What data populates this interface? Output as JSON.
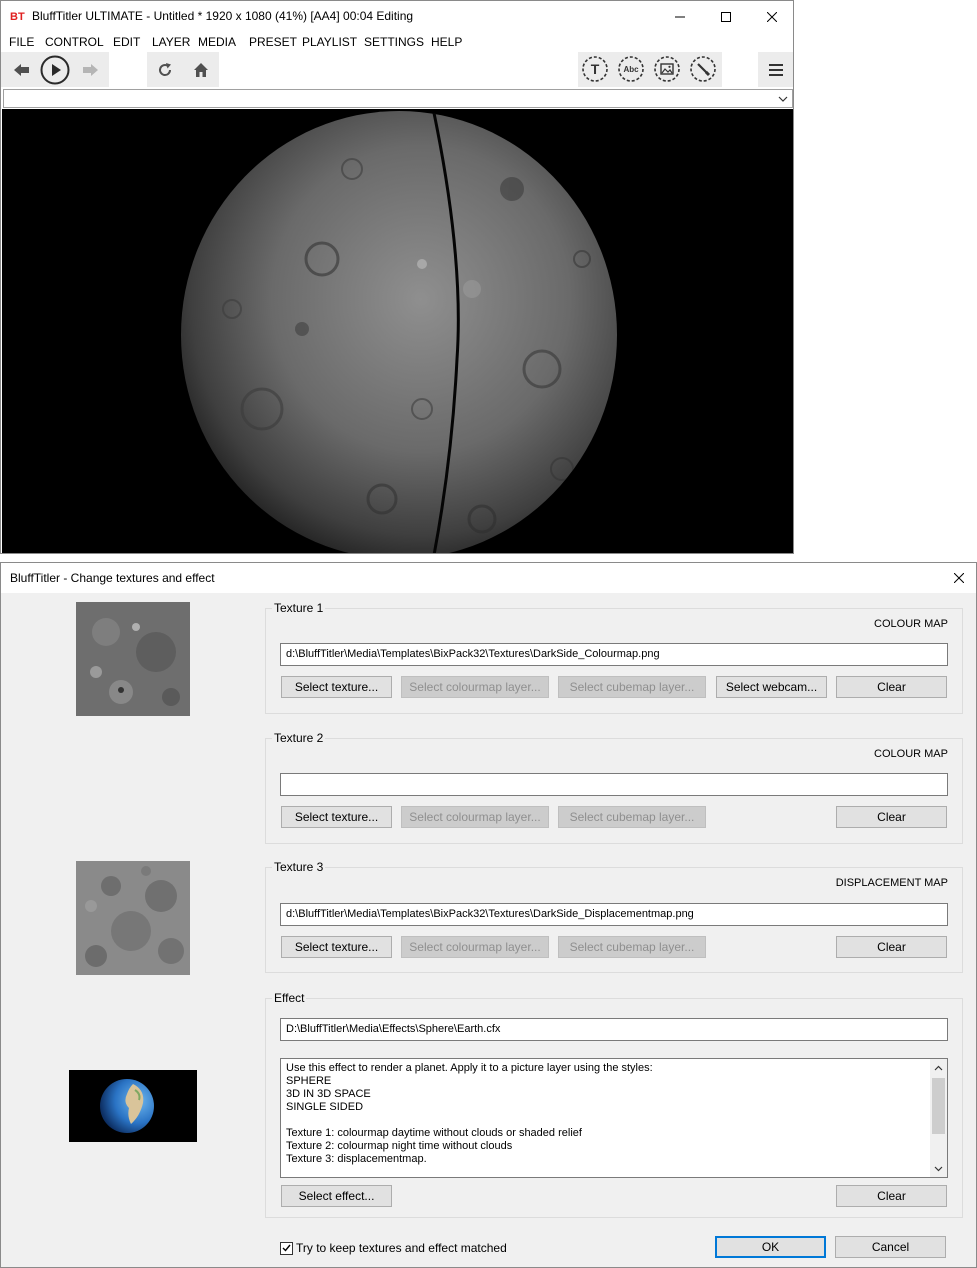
{
  "main_window": {
    "title": "BluffTitler ULTIMATE  - Untitled * 1920 x 1080 (41%) [AA4] 00:04 Editing",
    "logo": "BT",
    "menu": [
      "FILE",
      "CONTROL",
      "EDIT",
      "LAYER",
      "MEDIA",
      "PRESET",
      "PLAYLIST",
      "SETTINGS",
      "HELP"
    ],
    "toolbar_icons": {
      "nav": [
        "arrow-left-icon",
        "play-icon",
        "arrow-right-icon"
      ],
      "view": [
        "refresh-icon",
        "home-icon"
      ],
      "layers": [
        "text-layer-icon",
        "abc-layer-icon",
        "picture-layer-icon",
        "brush-icon"
      ],
      "menu": "hamburger-menu-icon"
    },
    "add_layer_labels": [
      "T",
      "Abc"
    ],
    "preset_value": ""
  },
  "dialog": {
    "title": "BluffTitler - Change textures and effect",
    "texture1": {
      "title": "Texture 1",
      "map_type": "COLOUR MAP",
      "path": "d:\\BluffTitler\\Media\\Templates\\BixPack32\\Textures\\DarkSide_Colourmap.png",
      "buttons": {
        "select_texture": "Select texture...",
        "select_colourmap_layer": "Select colourmap layer...",
        "select_cubemap_layer": "Select cubemap layer...",
        "select_webcam": "Select webcam...",
        "clear": "Clear"
      }
    },
    "texture2": {
      "title": "Texture 2",
      "map_type": "COLOUR MAP",
      "path": "",
      "buttons": {
        "select_texture": "Select texture...",
        "select_colourmap_layer": "Select colourmap layer...",
        "select_cubemap_layer": "Select cubemap layer...",
        "clear": "Clear"
      }
    },
    "texture3": {
      "title": "Texture 3",
      "map_type": "DISPLACEMENT MAP",
      "path": "d:\\BluffTitler\\Media\\Templates\\BixPack32\\Textures\\DarkSide_Displacementmap.png",
      "buttons": {
        "select_texture": "Select texture...",
        "select_colourmap_layer": "Select colourmap layer...",
        "select_cubemap_layer": "Select cubemap layer...",
        "clear": "Clear"
      }
    },
    "effect": {
      "title": "Effect",
      "path": "D:\\BluffTitler\\Media\\Effects\\Sphere\\Earth.cfx",
      "description": "Use this effect to render a planet. Apply it to a picture layer using the styles:\nSPHERE\n3D IN 3D SPACE\nSINGLE SIDED\n\nTexture 1: colourmap daytime without clouds or shaded relief\nTexture 2: colourmap night time without clouds\nTexture 3: displacementmap.",
      "buttons": {
        "select_effect": "Select effect...",
        "clear": "Clear"
      }
    },
    "keep_matched": {
      "label": "Try to keep textures and effect matched",
      "checked": true
    },
    "ok": "OK",
    "cancel": "Cancel"
  },
  "colors": {
    "dialog_bg": "#f0f0f0",
    "button_bg": "#e1e1e1",
    "disabled_text": "#8f8f8f",
    "focus_border": "#0078d7",
    "logo_red": "#e02020"
  }
}
